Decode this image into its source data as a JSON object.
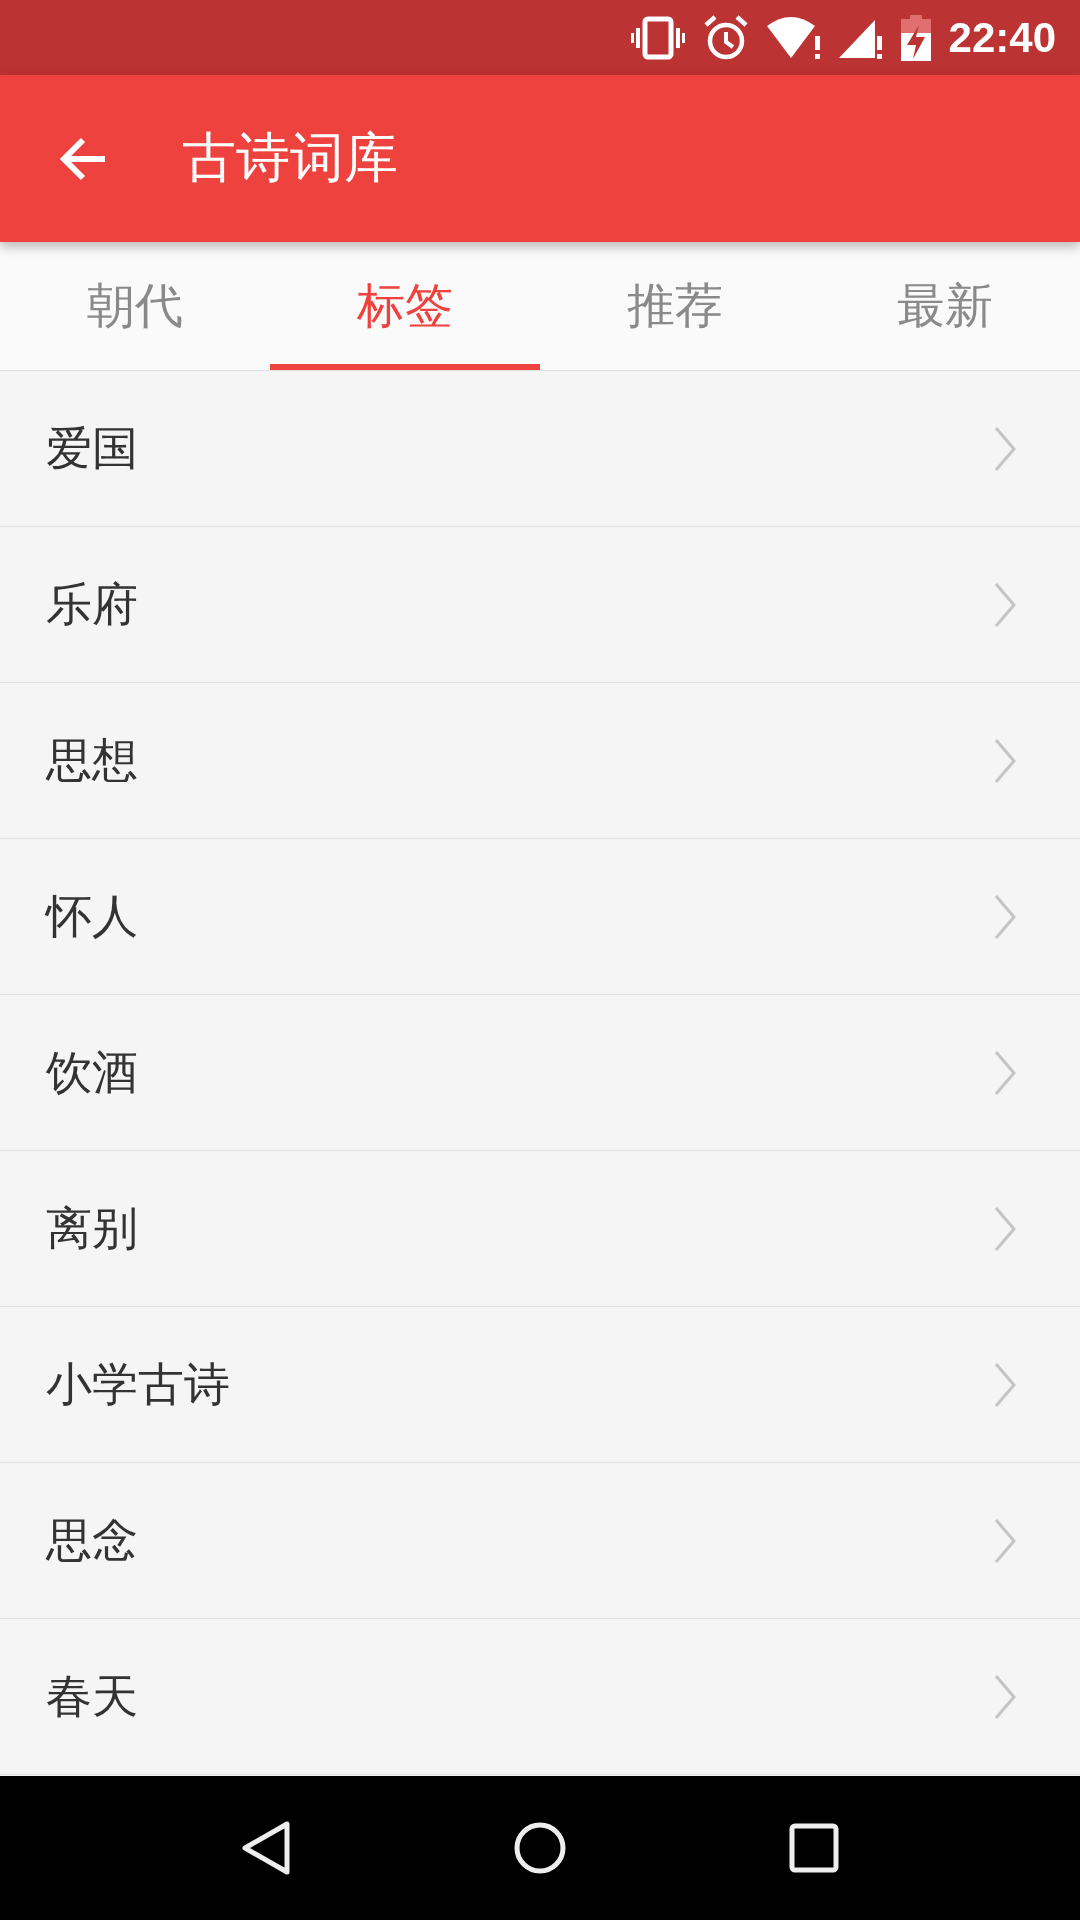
{
  "status_bar": {
    "time": "22:40"
  },
  "app_bar": {
    "title": "古诗词库"
  },
  "tabs": [
    {
      "label": "朝代",
      "selected": false
    },
    {
      "label": "标签",
      "selected": true
    },
    {
      "label": "推荐",
      "selected": false
    },
    {
      "label": "最新",
      "selected": false
    }
  ],
  "items": [
    {
      "label": "爱国"
    },
    {
      "label": "乐府"
    },
    {
      "label": "思想"
    },
    {
      "label": "怀人"
    },
    {
      "label": "饮酒"
    },
    {
      "label": "离别"
    },
    {
      "label": "小学古诗"
    },
    {
      "label": "思念"
    },
    {
      "label": "春天"
    }
  ]
}
